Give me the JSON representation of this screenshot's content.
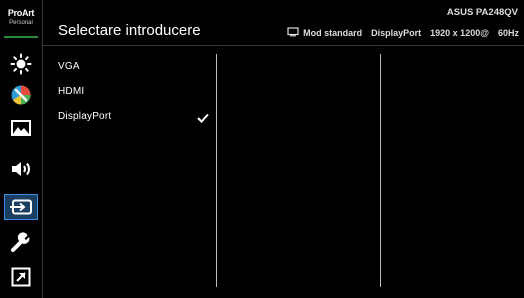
{
  "logo": {
    "line1": "ProArt",
    "line2": "Personal"
  },
  "sidebar": {
    "items": [
      {
        "icon": "brightness-icon",
        "active": false
      },
      {
        "icon": "color-icon",
        "active": false
      },
      {
        "icon": "image-icon",
        "active": false
      },
      {
        "icon": "sound-icon",
        "active": false
      },
      {
        "icon": "input-select-icon",
        "active": true
      },
      {
        "icon": "system-setup-icon",
        "active": false
      },
      {
        "icon": "shortcut-icon",
        "active": false
      }
    ]
  },
  "header": {
    "title": "Selectare introducere",
    "model": "ASUS PA248QV",
    "mode": "Mod standard",
    "input": "DisplayPort",
    "resolution": "1920 x 1200@",
    "refresh": "60Hz"
  },
  "menu": {
    "items": [
      {
        "label": "VGA",
        "selected": false
      },
      {
        "label": "HDMI",
        "selected": false
      },
      {
        "label": "DisplayPort",
        "selected": true
      }
    ]
  },
  "colors": {
    "accent": "#3a8fe0",
    "active_bg": "#1a3f63",
    "logo_underline": "#2a8a3a"
  }
}
